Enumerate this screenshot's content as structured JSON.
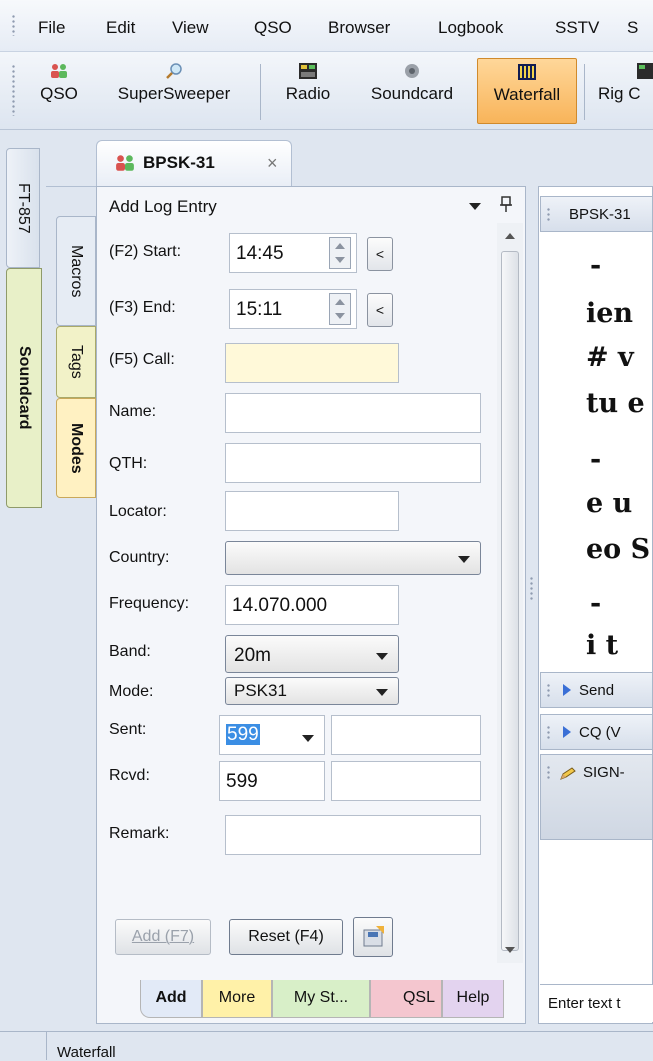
{
  "menu": [
    "File",
    "Edit",
    "View",
    "QSO",
    "Browser",
    "Logbook",
    "SSTV",
    "S"
  ],
  "toolbar": {
    "buttons": [
      {
        "label": "QSO",
        "icon": "people-icon"
      },
      {
        "label": "SuperSweeper",
        "icon": "magnifier-icon"
      },
      {
        "label": "Radio",
        "icon": "radio-icon"
      },
      {
        "label": "Soundcard",
        "icon": "speaker-icon"
      },
      {
        "label": "Waterfall",
        "icon": "waterfall-icon"
      },
      {
        "label": "Rig C",
        "icon": "rig-icon"
      }
    ],
    "active": "Waterfall"
  },
  "outer_tabs": {
    "ft857": "FT-857",
    "soundcard": "Soundcard"
  },
  "doc_tab": {
    "title": "BPSK-31",
    "close": "×"
  },
  "log_panel": {
    "title": "Add Log Entry",
    "side_tabs": {
      "macros": "Macros",
      "tags": "Tags",
      "modes": "Modes"
    },
    "start": {
      "label": "(F2)  Start:",
      "value": "14:45",
      "lt": "<"
    },
    "end": {
      "label": "(F3)  End:",
      "value": "15:11",
      "lt": "<"
    },
    "call": {
      "label": "(F5)  Call:",
      "value": ""
    },
    "name": {
      "label": "Name:",
      "value": ""
    },
    "qth": {
      "label": "QTH:",
      "value": ""
    },
    "locator": {
      "label": "Locator:",
      "value": ""
    },
    "country": {
      "label": "Country:",
      "value": ""
    },
    "frequency": {
      "label": "Frequency:",
      "value": "14.070.000"
    },
    "band": {
      "label": "Band:",
      "value": "20m"
    },
    "mode": {
      "label": "Mode:",
      "value": "PSK31"
    },
    "sent": {
      "label": "Sent:",
      "value": "599",
      "extra": ""
    },
    "rcvd": {
      "label": "Rcvd:",
      "value": "599",
      "extra": ""
    },
    "remark": {
      "label": "Remark:",
      "value": ""
    },
    "buttons": {
      "add": "Add (F7)",
      "reset": "Reset (F4)"
    },
    "bottom_tabs": [
      "Add",
      "More",
      "My St...",
      "QSL",
      "Help"
    ]
  },
  "terminal": {
    "header": "BPSK-31",
    "lines": [
      "-",
      "ien",
      " # v",
      "tu e",
      "-",
      "e u",
      "eo S",
      "-",
      "i  t"
    ],
    "panels": [
      "Send",
      "CQ (V",
      "SIGN-"
    ],
    "input_placeholder": "Enter text t"
  },
  "statusbar": {
    "label": "Waterfall"
  }
}
